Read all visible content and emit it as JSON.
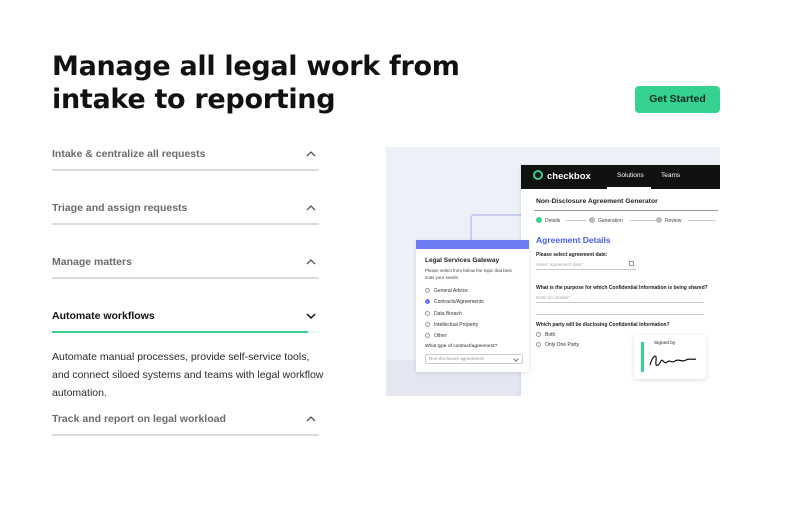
{
  "headline": {
    "line1": "Manage all legal work from",
    "line2": "intake to reporting"
  },
  "cta": {
    "label": "Get Started"
  },
  "accordion": {
    "items": [
      {
        "title": "Intake & centralize all requests",
        "expanded": false
      },
      {
        "title": "Triage and assign requests",
        "expanded": false
      },
      {
        "title": "Manage matters",
        "expanded": false
      },
      {
        "title": "Automate workflows",
        "expanded": true,
        "body": "Automate manual processes, provide self-service tools, and connect siloed systems and teams with legal workflow automation.",
        "progress": 0.96
      },
      {
        "title": "Track and report on legal workload",
        "expanded": false
      }
    ]
  },
  "colors": {
    "accent": "#35d38f",
    "brand_blue": "#4a5ee0",
    "form_header": "#6a7af0"
  },
  "app": {
    "brand": "checkbox",
    "nav": [
      "Solutions",
      "Teams"
    ],
    "doc_title": "Non-Disclosure Agreement Generator",
    "steps": [
      "Details",
      "Generation",
      "Review"
    ],
    "section_title": "Agreement Details",
    "q1": "Please select agreement date:",
    "q1_placeholder": "Select agreement date*",
    "q2": "What is the purpose for which Confidential Information is being shared?",
    "q2_placeholder": "Enter an answer*",
    "q3": "Which party will be disclosing Confidential Information?",
    "q3_options": [
      "Both",
      "Only One Party"
    ],
    "signature_label": "Signed by"
  },
  "gateway": {
    "title": "Legal Services Gateway",
    "desc": "Please select from below the topic that best suits your needs:",
    "options": [
      "General Advice",
      "Contracts/Agreements",
      "Data Breach",
      "Intellectual Property",
      "Other"
    ],
    "selected": "Contracts/Agreements",
    "question": "What type of contract/agreement?",
    "select_value": "Non-disclosure agreements"
  }
}
